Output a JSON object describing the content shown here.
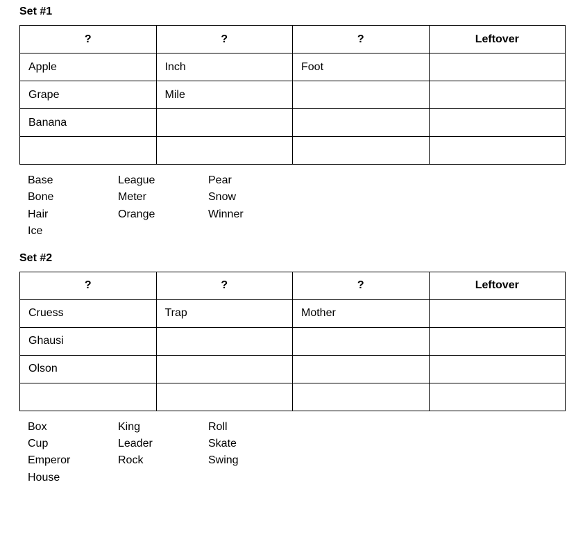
{
  "sets": [
    {
      "title": "Set #1",
      "headers": [
        "?",
        "?",
        "?",
        "Leftover"
      ],
      "rows": [
        [
          "Apple",
          "Inch",
          "Foot",
          ""
        ],
        [
          "Grape",
          "Mile",
          "",
          ""
        ],
        [
          "Banana",
          "",
          "",
          ""
        ],
        [
          "",
          "",
          "",
          ""
        ]
      ],
      "word_bank": [
        [
          "Base",
          "Bone",
          "Hair",
          "Ice"
        ],
        [
          "League",
          "Meter",
          "Orange"
        ],
        [
          "Pear",
          "Snow",
          "Winner"
        ]
      ]
    },
    {
      "title": "Set #2",
      "headers": [
        "?",
        "?",
        "?",
        "Leftover"
      ],
      "rows": [
        [
          "Cruess",
          "Trap",
          "Mother",
          ""
        ],
        [
          "Ghausi",
          "",
          "",
          ""
        ],
        [
          "Olson",
          "",
          "",
          ""
        ],
        [
          "",
          "",
          "",
          ""
        ]
      ],
      "word_bank": [
        [
          "Box",
          "Cup",
          "Emperor",
          "House"
        ],
        [
          "King",
          "Leader",
          "Rock"
        ],
        [
          "Roll",
          "Skate",
          "Swing"
        ]
      ]
    }
  ]
}
